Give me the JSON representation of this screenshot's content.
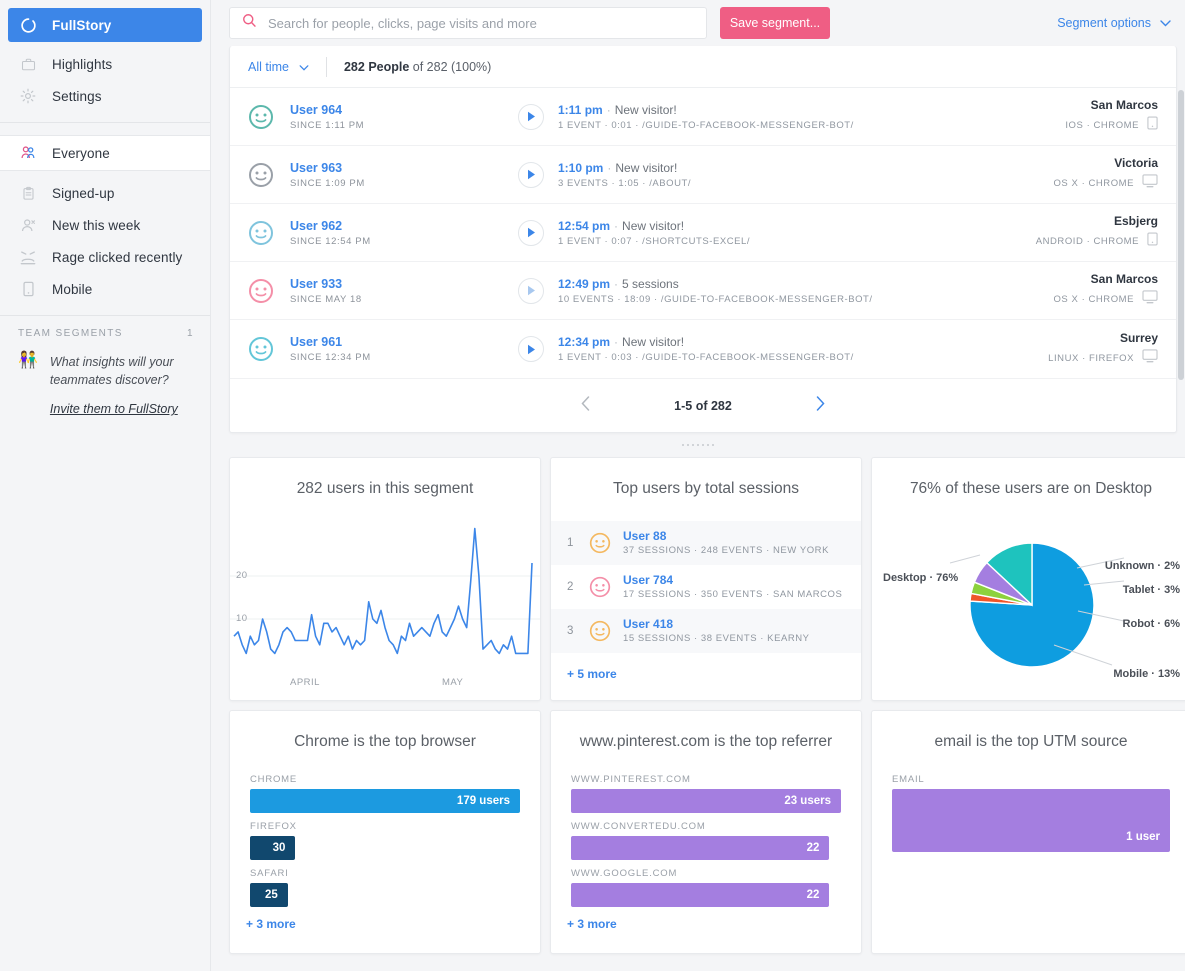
{
  "sidebar": {
    "brand": "FullStory",
    "top_items": [
      {
        "label": "Highlights",
        "icon": "briefcase-icon"
      },
      {
        "label": "Settings",
        "icon": "gear-icon"
      }
    ],
    "segments": [
      {
        "label": "Everyone",
        "icon": "people-icon",
        "selected": true
      },
      {
        "label": "Signed-up",
        "icon": "clipboard-icon",
        "selected": false
      },
      {
        "label": "New this week",
        "icon": "new-user-icon",
        "selected": false
      },
      {
        "label": "Rage clicked recently",
        "icon": "angry-face-icon",
        "selected": false
      },
      {
        "label": "Mobile",
        "icon": "phone-icon",
        "selected": false
      }
    ],
    "team_section_title": "TEAM SEGMENTS",
    "team_section_count": "1",
    "team_blurb": "What insights will your teammates discover?",
    "team_invite": "Invite them to FullStory"
  },
  "topbar": {
    "search_placeholder": "Search for people, clicks, page visits and more",
    "search_value": "",
    "save_label": "Save segment...",
    "segment_options": "Segment options",
    "accent_pink": "#ef5e84",
    "accent_blue": "#3c86e8"
  },
  "filterbar": {
    "time_range": "All time",
    "count_bold": "282 People",
    "count_rest": " of 282 (100%)"
  },
  "users": [
    {
      "name": "User 964",
      "since": "SINCE 1:11 PM",
      "time": "1:11 pm",
      "event_title": "New visitor!",
      "meta": "1 EVENT · 0:01 · /GUIDE-TO-FACEBOOK-MESSENGER-BOT/",
      "location": "San Marcos",
      "device_text": "IOS · CHROME",
      "device_icon": "mobile-icon",
      "avatar_color": "#5cb8ac",
      "play_active": true
    },
    {
      "name": "User 963",
      "since": "SINCE 1:09 PM",
      "time": "1:10 pm",
      "event_title": "New visitor!",
      "meta": "3 EVENTS · 1:05 · /ABOUT/",
      "location": "Victoria",
      "device_text": "OS X · CHROME",
      "device_icon": "desktop-icon",
      "avatar_color": "#9aa0a8",
      "play_active": true
    },
    {
      "name": "User 962",
      "since": "SINCE 12:54 PM",
      "time": "12:54 pm",
      "event_title": "New visitor!",
      "meta": "1 EVENT · 0:07 · /SHORTCUTS-EXCEL/",
      "location": "Esbjerg",
      "device_text": "ANDROID · CHROME",
      "device_icon": "mobile-icon",
      "avatar_color": "#7fc4dd",
      "play_active": true
    },
    {
      "name": "User 933",
      "since": "SINCE MAY 18",
      "time": "12:49 pm",
      "event_title": "5 sessions",
      "meta": "10 EVENTS · 18:09 · /GUIDE-TO-FACEBOOK-MESSENGER-BOT/",
      "location": "San Marcos",
      "device_text": "OS X · CHROME",
      "device_icon": "desktop-icon",
      "avatar_color": "#f48fa8",
      "play_active": false
    },
    {
      "name": "User 961",
      "since": "SINCE 12:34 PM",
      "time": "12:34 pm",
      "event_title": "New visitor!",
      "meta": "1 EVENT · 0:03 · /GUIDE-TO-FACEBOOK-MESSENGER-BOT/",
      "location": "Surrey",
      "device_text": "LINUX · FIREFOX",
      "device_icon": "desktop-icon",
      "avatar_color": "#63c6d8",
      "play_active": true
    }
  ],
  "pager": {
    "prev": "‹",
    "range": "1-5 of 282",
    "next": "›"
  },
  "cards": {
    "users_segment": {
      "title": "282 users in this segment"
    },
    "top_users": {
      "title": "Top users by total sessions",
      "rows": [
        {
          "rank": "1",
          "name": "User 88",
          "meta": "37 SESSIONS · 248 EVENTS · NEW YORK",
          "avatar_color": "#f4b860"
        },
        {
          "rank": "2",
          "name": "User 784",
          "meta": "17 SESSIONS · 350 EVENTS · SAN MARCOS",
          "avatar_color": "#f48fa8"
        },
        {
          "rank": "3",
          "name": "User 418",
          "meta": "15 SESSIONS · 38 EVENTS · KEARNY",
          "avatar_color": "#f4b860"
        }
      ],
      "more": "+ 5 more"
    },
    "devices": {
      "title": "76% of these users are on Desktop"
    },
    "browsers": {
      "title": "Chrome is the top browser",
      "more": "+ 3 more"
    },
    "referrers": {
      "title": "www.pinterest.com is the top referrer",
      "more": "+ 3 more"
    },
    "utm": {
      "title": "email is the top UTM source"
    }
  },
  "chart_data": [
    {
      "type": "line",
      "title": "282 users in this segment",
      "xlabel": "",
      "ylabel": "",
      "ylim": [
        0,
        33
      ],
      "yticks": [
        10,
        20
      ],
      "xticks": [
        "APRIL",
        "MAY"
      ],
      "grid": true,
      "line_color": "#3c86e8",
      "values": [
        6,
        7,
        4,
        2,
        6,
        4,
        5,
        10,
        7,
        3,
        2,
        4,
        7,
        8,
        7,
        5,
        5,
        5,
        5,
        11,
        6,
        4,
        9,
        9,
        7,
        8,
        6,
        4,
        6,
        3,
        5,
        4,
        5,
        14,
        10,
        9,
        12,
        8,
        5,
        4,
        2,
        6,
        5,
        9,
        6,
        7,
        8,
        7,
        6,
        9,
        11,
        7,
        6,
        8,
        10,
        13,
        10,
        8,
        19,
        31,
        20,
        3,
        4,
        5,
        3,
        2,
        4,
        3,
        6,
        2,
        2,
        2,
        2,
        23
      ]
    },
    {
      "type": "pie",
      "title": "76% of these users are on Desktop",
      "labels": [
        "Desktop",
        "Unknown",
        "Tablet",
        "Robot",
        "Mobile"
      ],
      "values": [
        76,
        2,
        3,
        6,
        13
      ],
      "display_labels": [
        "Desktop · 76%",
        "Unknown · 2%",
        "Tablet · 3%",
        "Robot · 6%",
        "Mobile · 13%"
      ],
      "colors": [
        "#0e9de0",
        "#f0552a",
        "#8cd13d",
        "#a47ee0",
        "#1ec3be"
      ],
      "legend": "callout"
    },
    {
      "type": "bar",
      "title": "Chrome is the top browser",
      "orientation": "horizontal",
      "categories": [
        "CHROME",
        "FIREFOX",
        "SAFARI"
      ],
      "values": [
        179,
        30,
        25
      ],
      "value_labels": [
        "179 users",
        "30",
        "25"
      ],
      "colors": [
        "#1c9ae0",
        "#11486e",
        "#11486e"
      ],
      "ylabel": "",
      "xlabel": ""
    },
    {
      "type": "bar",
      "title": "www.pinterest.com is the top referrer",
      "orientation": "horizontal",
      "categories": [
        "WWW.PINTEREST.COM",
        "WWW.CONVERTEDU.COM",
        "WWW.GOOGLE.COM"
      ],
      "values": [
        23,
        22,
        22
      ],
      "value_labels": [
        "23 users",
        "22",
        "22"
      ],
      "colors": [
        "#a47ee0",
        "#a47ee0",
        "#a47ee0"
      ],
      "ylabel": "",
      "xlabel": ""
    },
    {
      "type": "bar",
      "title": "email is the top UTM source",
      "orientation": "horizontal",
      "categories": [
        "EMAIL"
      ],
      "values": [
        1
      ],
      "value_labels": [
        "1 user"
      ],
      "colors": [
        "#a47ee0"
      ],
      "ylabel": "",
      "xlabel": ""
    }
  ]
}
